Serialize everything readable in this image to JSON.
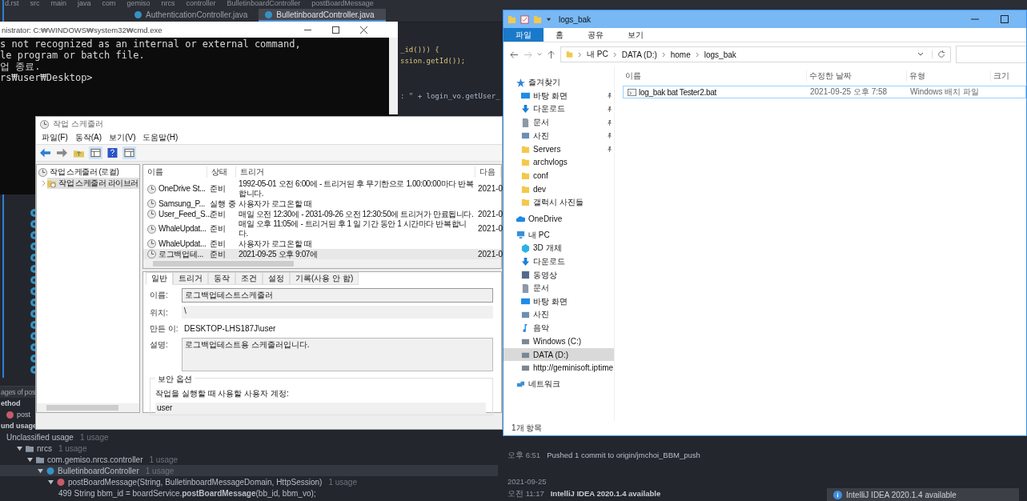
{
  "ide": {
    "breadcrumb": [
      "d.rst",
      "src",
      "main",
      "java",
      "com",
      "gemiso",
      "nrcs",
      "controller",
      "BulletinboardController",
      "postBoardMessage"
    ],
    "editor_tabs": [
      {
        "label": "AuthenticationController.java",
        "selected": false
      },
      {
        "label": "BulletinboardController.java",
        "selected": true
      }
    ],
    "code_lines": [
      "_id())) {",
      "ssion.getId());",
      ": \" + login_vo.getUser_"
    ],
    "find_panel": {
      "title": "ages of pos",
      "group_label": "ethod",
      "method": "post",
      "found_label": "und usage",
      "tree": [
        {
          "label": "Unclassified usage",
          "count": "1 usage",
          "selected": false,
          "children": [
            {
              "label": "nrcs",
              "count": "1 usage",
              "kind": "package",
              "expanded": true,
              "selected": false,
              "children": [
                {
                  "label": "com.gemiso.nrcs.controller",
                  "count": "1 usage",
                  "kind": "package",
                  "expanded": true,
                  "selected": false,
                  "children": [
                    {
                      "label": "BulletinboardController",
                      "count": "1 usage",
                      "kind": "class",
                      "expanded": true,
                      "selected": true,
                      "children": [
                        {
                          "label": "postBoardMessage(String, BulletinboardMessageDomain, HttpSession)",
                          "count": "1 usage",
                          "kind": "method",
                          "expanded": true,
                          "selected": false,
                          "children": [
                            {
                              "label": "499 String bbm_id = boardService.**postBoardMessage**(bb_id, bbm_vo);",
                              "kind": "line",
                              "selected": false
                            }
                          ]
                        }
                      ]
                    }
                  ]
                }
              ]
            }
          ]
        }
      ]
    },
    "event_log": [
      {
        "kind": "event",
        "time": "오후 6:51",
        "message": "Pushed 1 commit to origin/jmchoi_BBM_push"
      },
      {
        "kind": "date",
        "time": "2021-09-25"
      },
      {
        "kind": "notice",
        "time": "오전 11:17",
        "message": "IntelliJ IDEA 2020.1.4 available"
      }
    ],
    "notification": "IntelliJ IDEA 2020.1.4 available"
  },
  "cmd": {
    "title": "nistrator: C:₩WINDOWS₩system32₩cmd.exe",
    "lines": [
      "s not recognized as an internal or external command,",
      "le program or batch file.",
      "업 종료.",
      "rs₩user₩Desktop>"
    ]
  },
  "scheduler": {
    "title": "작업 스케줄러",
    "menu": [
      "파일(F)",
      "동작(A)",
      "보기(V)",
      "도움말(H)"
    ],
    "tree": [
      {
        "label": "작업 스케줄러 (로컬)",
        "selected": false,
        "children": [
          {
            "label": "작업 스케줄러 라이브러",
            "selected": true,
            "expanded": false
          }
        ]
      }
    ],
    "columns": [
      "이름",
      "상태",
      "트리거",
      "다음"
    ],
    "tasks": [
      {
        "name": "OneDrive St...",
        "status": "준비",
        "trigger": "1992-05-01 오전 6:00에 - 트리거된 후 무기한으로 1.00:00:00마다 반복합니다.",
        "next": "2021-0",
        "selected": false
      },
      {
        "name": "Samsung_P...",
        "status": "실행 중",
        "trigger": "사용자가 로그온할 때",
        "selected": false
      },
      {
        "name": "User_Feed_S...",
        "status": "준비",
        "trigger": "매일 오전 12:30에 - 2031-09-26 오전 12:30:50에 트리거가 만료됩니다.",
        "next": "2021-0",
        "selected": false
      },
      {
        "name": "WhaleUpdat...",
        "status": "준비",
        "trigger": "매일 오후 11:05에 - 트리거된 후 1 일 기간 동안 1 시간마다 반복합니다.",
        "next": "2021-0",
        "selected": false
      },
      {
        "name": "WhaleUpdat...",
        "status": "준비",
        "trigger": "사용자가 로그온할 때",
        "selected": false
      },
      {
        "name": "로그백업테...",
        "status": "준비",
        "trigger": "2021-09-25 오후 9:07에",
        "next": "2021-0",
        "selected": true
      }
    ],
    "detail_tabs": [
      {
        "label": "일반",
        "selected": true
      },
      {
        "label": "트리거",
        "selected": false
      },
      {
        "label": "동작",
        "selected": false
      },
      {
        "label": "조건",
        "selected": false
      },
      {
        "label": "설정",
        "selected": false
      },
      {
        "label": "기록(사용 안 함)",
        "selected": false
      }
    ],
    "fields": [
      {
        "label": "이름:",
        "value": "로그백업테스트스케줄러",
        "kind": "box"
      },
      {
        "label": "위치:",
        "value": "\\",
        "kind": "shaded"
      },
      {
        "label": "만든 이:",
        "value": "DESKTOP-LHS187J\\user",
        "kind": "plain"
      },
      {
        "label": "설명:",
        "value": "로그백업테스트용 스케줄러입니다.",
        "kind": "area"
      }
    ],
    "security": {
      "title": "보안 옵션",
      "account_label": "작업을 실행할 때 사용할 사용자 계정:",
      "account": "user"
    }
  },
  "explorer": {
    "title": "logs_bak",
    "ribbon_tabs": [
      {
        "label": "파일",
        "selected": true
      },
      {
        "label": "홈",
        "selected": false
      },
      {
        "label": "공유",
        "selected": false
      },
      {
        "label": "보기",
        "selected": false
      }
    ],
    "breadcrumb": [
      "내 PC",
      "DATA (D:)",
      "home",
      "logs_bak"
    ],
    "nav": [
      {
        "label": "즐겨찾기",
        "kind": "star",
        "selected": false,
        "children": [
          {
            "label": "바탕 화면",
            "kind": "desktop",
            "pinned": true,
            "selected": false
          },
          {
            "label": "다운로드",
            "kind": "download",
            "pinned": true,
            "selected": false
          },
          {
            "label": "문서",
            "kind": "document",
            "pinned": true,
            "selected": false
          },
          {
            "label": "사진",
            "kind": "picture",
            "pinned": true,
            "selected": false
          },
          {
            "label": "Servers",
            "kind": "folder",
            "pinned": true,
            "selected": false
          },
          {
            "label": "archvlogs",
            "kind": "folder",
            "pinned": false,
            "selected": false
          },
          {
            "label": "conf",
            "kind": "folder",
            "pinned": false,
            "selected": false
          },
          {
            "label": "dev",
            "kind": "folder",
            "pinned": false,
            "selected": false
          },
          {
            "label": "갤럭시 사진들",
            "kind": "folder",
            "pinned": false,
            "selected": false
          }
        ]
      },
      {
        "label": "OneDrive",
        "kind": "cloud",
        "selected": false
      },
      {
        "label": "내 PC",
        "kind": "pc",
        "selected": false,
        "children": [
          {
            "label": "3D 개체",
            "kind": "cube",
            "selected": false
          },
          {
            "label": "다운로드",
            "kind": "download",
            "selected": false
          },
          {
            "label": "동영상",
            "kind": "video",
            "selected": false
          },
          {
            "label": "문서",
            "kind": "document",
            "selected": false
          },
          {
            "label": "바탕 화면",
            "kind": "desktop",
            "selected": false
          },
          {
            "label": "사진",
            "kind": "picture",
            "selected": false
          },
          {
            "label": "음악",
            "kind": "music",
            "selected": false
          },
          {
            "label": "Windows (C:)",
            "kind": "drive",
            "selected": false
          },
          {
            "label": "DATA (D:)",
            "kind": "drive",
            "selected": true
          },
          {
            "label": "http://geminisoft.iptime",
            "kind": "netdrive",
            "selected": false
          }
        ]
      },
      {
        "label": "네트워크",
        "kind": "network",
        "selected": false
      }
    ],
    "columns": [
      "이름",
      "수정한 날짜",
      "유형",
      "크기"
    ],
    "files": [
      {
        "name": "log_bak bat Tester2.bat",
        "modified": "2021-09-25 오후 7:58",
        "type": "Windows 배치 파일",
        "selected": true
      }
    ],
    "status": "1개 항목"
  }
}
